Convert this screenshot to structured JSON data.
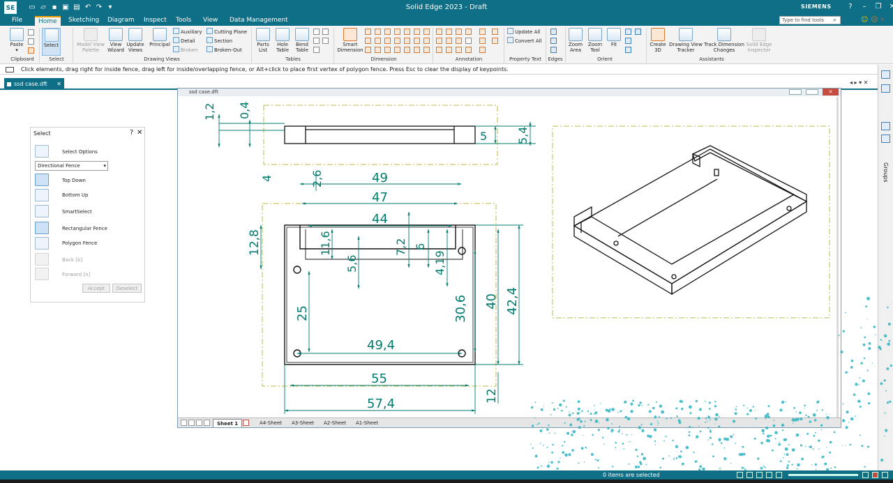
{
  "app": {
    "logo": "SE",
    "title": "Solid Edge 2023 - Draft",
    "brand": "SIEMENS",
    "search_placeholder": "Type to find tools",
    "window_controls": [
      "?",
      "–",
      "❐",
      "✕"
    ]
  },
  "menu": {
    "tabs": [
      "File",
      "Home",
      "Sketching",
      "Diagram",
      "Inspect",
      "Tools",
      "View",
      "Data Management"
    ],
    "active": "Home"
  },
  "ribbon": {
    "clipboard": {
      "paste": "Paste",
      "group": "Clipboard"
    },
    "select": {
      "label": "Select",
      "group": "Select"
    },
    "drawing_views": {
      "model_view_palette": "Model View Palette",
      "view_wizard": "View Wizard",
      "update_views": "Update Views",
      "principal": "Principal",
      "auxiliary": "Auxiliary",
      "detail": "Detail",
      "broken": "Broken",
      "cutting_plane": "Cutting Plane",
      "section": "Section",
      "broken_out": "Broken-Out",
      "group": "Drawing Views"
    },
    "tables": {
      "parts_list": "Parts List",
      "hole_table": "Hole Table",
      "bend_table": "Bend Table",
      "group": "Tables"
    },
    "dimension": {
      "smart_dimension": "Smart Dimension",
      "group": "Dimension"
    },
    "annotation": {
      "group": "Annotation"
    },
    "property_text": {
      "update_all": "Update All",
      "convert_all": "Convert All",
      "group": "Property Text"
    },
    "edges": {
      "group": "Edges"
    },
    "orient": {
      "zoom_area": "Zoom Area",
      "zoom_tool": "Zoom Tool",
      "fit": "Fit",
      "group": "Orient"
    },
    "assistants": {
      "create_3d": "Create 3D",
      "drawing_view_tracker": "Drawing View Tracker",
      "track_dimension_changes": "Track Dimension Changes",
      "solid_edge_inspector": "Solid Edge Inspector",
      "group": "Assistants"
    }
  },
  "prompt": "Click elements, drag right for inside fence, drag left for inside/overlapping fence, or Alt+click to place first vertex of polygon fence. Press Esc to clear the display of keypoints.",
  "document": {
    "tab_label": "ssd case.dft",
    "window_title": "ssd case.dft",
    "sheets": [
      "Sheet 1",
      "A4-Sheet",
      "A3-Sheet",
      "A2-Sheet",
      "A1-Sheet"
    ],
    "active_sheet": "Sheet 1"
  },
  "select_panel": {
    "title": "Select",
    "help": "?",
    "close": "✕",
    "select_options": "Select Options",
    "fence_mode": "Directional Fence",
    "top_down": "Top Down",
    "bottom_up": "Bottom Up",
    "smart_select": "SmartSelect",
    "rectangular_fence": "Rectangular Fence",
    "polygon_fence": "Polygon Fence",
    "back": "Back [b]",
    "forward": "Forward [n]",
    "accept": "Accept",
    "deselect": "Deselect"
  },
  "side_panel": {
    "groups": "Groups"
  },
  "dimensions": {
    "top_view": [
      "1,2",
      "0,4",
      "5",
      "5,4",
      "4"
    ],
    "front_view": [
      "2,6",
      "49",
      "47",
      "44",
      "12,8",
      "11,6",
      "5,6",
      "7,2",
      "6",
      "4,19",
      "25",
      "30,6",
      "40",
      "42,4",
      "49,4",
      "55",
      "57,4",
      "12"
    ]
  },
  "status": {
    "selection": "0 items are selected"
  },
  "colors": {
    "chrome": "#0f6f86",
    "accent": "#f2a000",
    "dimension": "#007b6d",
    "border_line": "#b8b84a"
  }
}
